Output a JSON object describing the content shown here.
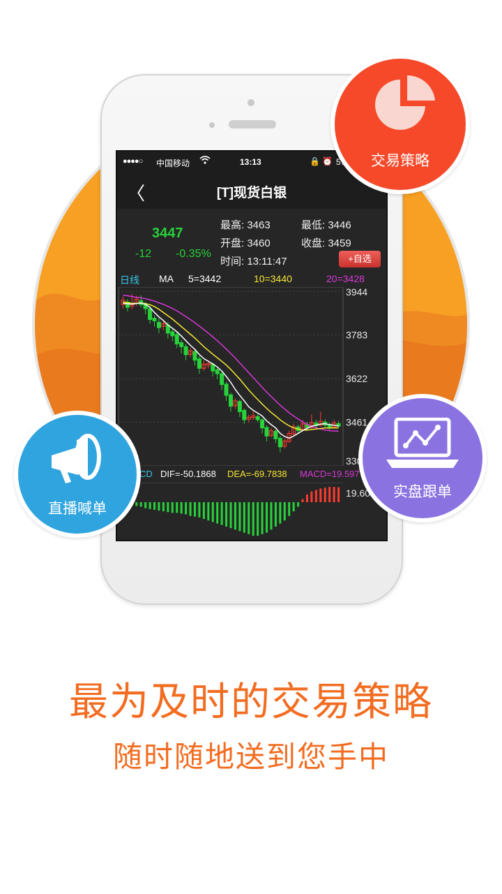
{
  "app": {
    "status_bar": {
      "signal": "●●●●○",
      "carrier": "中国移动",
      "wifi_icon": "wifi-icon",
      "time": "13:13",
      "icons": "🔒 ⏰",
      "battery": "57"
    },
    "nav": {
      "back_icon": "chevron-left-icon",
      "back_glyph": "〈",
      "title": "[T]现货白银"
    },
    "quote": {
      "price": "3447",
      "change": "-12",
      "change_pct": "-0.35%",
      "high": "最高: 3463",
      "low": "最低: 3446",
      "open": "开盘: 3460",
      "close": "收盘: 3459",
      "time": "时间: 13:11:47",
      "add_button": "+自选"
    },
    "indicators": {
      "period": "日线",
      "ma_label": "MA",
      "ma5": "5=3442",
      "ma10": "10=3440",
      "ma20": "20=3428",
      "macd_label": "CD",
      "dif": "DIF=-50.1868",
      "dea": "DEA=-69.7838",
      "macd": "MACD=19.597",
      "macd_axis": "19.60"
    },
    "colors": {
      "up": "#ff3b30",
      "down": "#27d23a",
      "ma5": "#ffffff",
      "ma10": "#f5e634",
      "ma20": "#d837d8",
      "accent": "#f26d21"
    }
  },
  "chart_data": {
    "type": "candlestick",
    "y_ticks": [
      "3944",
      "3783",
      "3622",
      "3461",
      "330"
    ],
    "ylim": [
      3300,
      3960
    ],
    "candles": [
      [
        3895,
        3912,
        3880,
        3925
      ],
      [
        3905,
        3885,
        3870,
        3915
      ],
      [
        3890,
        3900,
        3878,
        3935
      ],
      [
        3900,
        3915,
        3890,
        3928
      ],
      [
        3910,
        3895,
        3885,
        3930
      ],
      [
        3895,
        3880,
        3860,
        3905
      ],
      [
        3880,
        3840,
        3825,
        3890
      ],
      [
        3845,
        3835,
        3815,
        3855
      ],
      [
        3830,
        3810,
        3790,
        3845
      ],
      [
        3815,
        3825,
        3800,
        3840
      ],
      [
        3820,
        3790,
        3770,
        3830
      ],
      [
        3795,
        3780,
        3760,
        3805
      ],
      [
        3785,
        3750,
        3735,
        3795
      ],
      [
        3755,
        3740,
        3715,
        3765
      ],
      [
        3740,
        3710,
        3690,
        3750
      ],
      [
        3712,
        3725,
        3700,
        3735
      ],
      [
        3722,
        3690,
        3670,
        3730
      ],
      [
        3695,
        3660,
        3640,
        3705
      ],
      [
        3660,
        3675,
        3650,
        3690
      ],
      [
        3672,
        3678,
        3660,
        3690
      ],
      [
        3675,
        3650,
        3630,
        3682
      ],
      [
        3655,
        3640,
        3620,
        3665
      ],
      [
        3640,
        3600,
        3580,
        3650
      ],
      [
        3602,
        3560,
        3540,
        3610
      ],
      [
        3562,
        3520,
        3500,
        3570
      ],
      [
        3522,
        3540,
        3510,
        3550
      ],
      [
        3538,
        3500,
        3480,
        3545
      ],
      [
        3505,
        3470,
        3455,
        3512
      ],
      [
        3472,
        3480,
        3460,
        3490
      ],
      [
        3478,
        3485,
        3470,
        3500
      ],
      [
        3482,
        3470,
        3462,
        3490
      ],
      [
        3470,
        3440,
        3420,
        3478
      ],
      [
        3442,
        3410,
        3390,
        3450
      ],
      [
        3412,
        3430,
        3405,
        3440
      ],
      [
        3428,
        3400,
        3385,
        3436
      ],
      [
        3402,
        3370,
        3350,
        3410
      ],
      [
        3372,
        3392,
        3365,
        3400
      ],
      [
        3390,
        3420,
        3385,
        3430
      ],
      [
        3418,
        3445,
        3412,
        3455
      ],
      [
        3444,
        3430,
        3420,
        3452
      ],
      [
        3432,
        3455,
        3428,
        3470
      ],
      [
        3452,
        3440,
        3430,
        3462
      ],
      [
        3442,
        3460,
        3436,
        3490
      ],
      [
        3458,
        3448,
        3440,
        3470
      ],
      [
        3450,
        3465,
        3445,
        3500
      ],
      [
        3462,
        3450,
        3438,
        3472
      ],
      [
        3452,
        3440,
        3428,
        3460
      ],
      [
        3442,
        3458,
        3438,
        3470
      ],
      [
        3456,
        3446,
        3440,
        3466
      ]
    ],
    "ma5": [
      3900,
      3898,
      3897,
      3899,
      3901,
      3896,
      3885,
      3866,
      3850,
      3836,
      3820,
      3808,
      3795,
      3779,
      3762,
      3745,
      3730,
      3711,
      3696,
      3686,
      3676,
      3665,
      3650,
      3630,
      3608,
      3582,
      3560,
      3540,
      3518,
      3505,
      3495,
      3484,
      3466,
      3452,
      3440,
      3420,
      3408,
      3402,
      3410,
      3420,
      3430,
      3438,
      3446,
      3450,
      3454,
      3456,
      3452,
      3450,
      3447
    ],
    "ma10": [
      3905,
      3902,
      3900,
      3900,
      3901,
      3899,
      3895,
      3888,
      3878,
      3866,
      3854,
      3842,
      3828,
      3814,
      3800,
      3786,
      3772,
      3756,
      3740,
      3726,
      3712,
      3699,
      3686,
      3672,
      3656,
      3638,
      3620,
      3600,
      3580,
      3562,
      3545,
      3528,
      3512,
      3497,
      3484,
      3470,
      3458,
      3448,
      3440,
      3436,
      3432,
      3432,
      3434,
      3436,
      3438,
      3440,
      3440,
      3440,
      3440
    ],
    "ma20": [
      3930,
      3928,
      3925,
      3922,
      3920,
      3917,
      3913,
      3908,
      3902,
      3896,
      3889,
      3881,
      3872,
      3862,
      3851,
      3840,
      3828,
      3816,
      3803,
      3790,
      3776,
      3762,
      3747,
      3731,
      3715,
      3698,
      3680,
      3662,
      3644,
      3626,
      3608,
      3590,
      3572,
      3556,
      3540,
      3524,
      3510,
      3496,
      3484,
      3473,
      3462,
      3454,
      3446,
      3440,
      3436,
      3432,
      3430,
      3429,
      3428
    ],
    "macd_hist": [
      -2,
      -3,
      -4,
      -5,
      -6,
      -8,
      -9,
      -10,
      -11,
      -12,
      -13,
      -14,
      -14,
      -15,
      -16,
      -18,
      -19,
      -20,
      -22,
      -24,
      -26,
      -28,
      -30,
      -32,
      -34,
      -36,
      -38,
      -40,
      -42,
      -44,
      -44,
      -42,
      -40,
      -36,
      -32,
      -28,
      -24,
      -18,
      -12,
      -6,
      4,
      10,
      14,
      16,
      18,
      19,
      20,
      20,
      19.6
    ]
  },
  "badges": {
    "strategy": {
      "label": "交易策略",
      "icon": "pie-chart-icon"
    },
    "broadcast": {
      "label": "直播喊单",
      "icon": "megaphone-icon"
    },
    "follow": {
      "label": "实盘跟单",
      "icon": "laptop-chart-icon"
    }
  },
  "headline": {
    "main": "最为及时的交易策略",
    "sub": "随时随地送到您手中"
  }
}
